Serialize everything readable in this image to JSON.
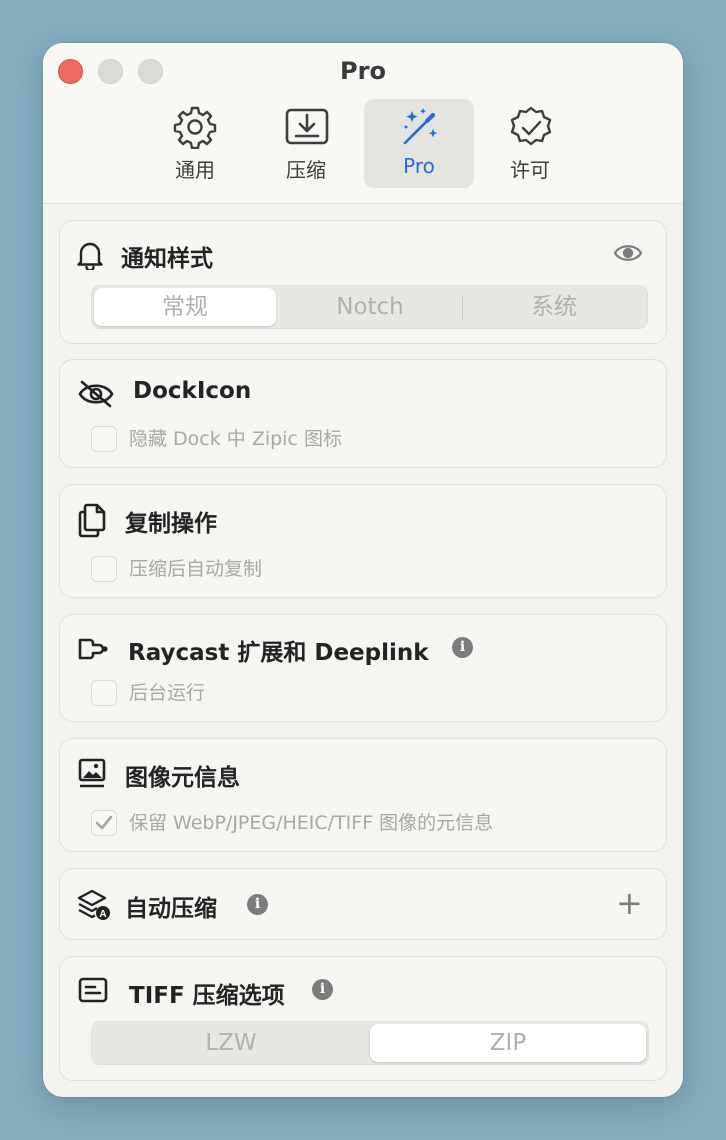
{
  "window": {
    "title": "Pro"
  },
  "tabs": [
    {
      "label": "通用",
      "icon": "gear-icon"
    },
    {
      "label": "压缩",
      "icon": "download-tray-icon"
    },
    {
      "label": "Pro",
      "icon": "magic-wand-icon",
      "active": true
    },
    {
      "label": "许可",
      "icon": "checkmark-seal-icon"
    }
  ],
  "notification_style": {
    "title": "通知样式",
    "options": [
      "常规",
      "Notch",
      "系统"
    ],
    "selected": "常规"
  },
  "dock_icon": {
    "title": "DockIcon",
    "checkbox_label": "隐藏 Dock 中 Zipic 图标",
    "checked": false
  },
  "copy_action": {
    "title": "复制操作",
    "checkbox_label": "压缩后自动复制",
    "checked": false
  },
  "raycast": {
    "title": "Raycast 扩展和 Deeplink",
    "checkbox_label": "后台运行",
    "checked": false
  },
  "image_metadata": {
    "title": "图像元信息",
    "checkbox_label": "保留 WebP/JPEG/HEIC/TIFF 图像的元信息",
    "checked": true
  },
  "auto_compress": {
    "title": "自动压缩",
    "add_symbol": "+"
  },
  "tiff_options": {
    "title": "TIFF 压缩选项",
    "options": [
      "LZW",
      "ZIP"
    ],
    "selected": "ZIP"
  },
  "colors": {
    "accent": "#1f6fd6",
    "background": "#84adc0",
    "close": "#ed6a5e"
  }
}
